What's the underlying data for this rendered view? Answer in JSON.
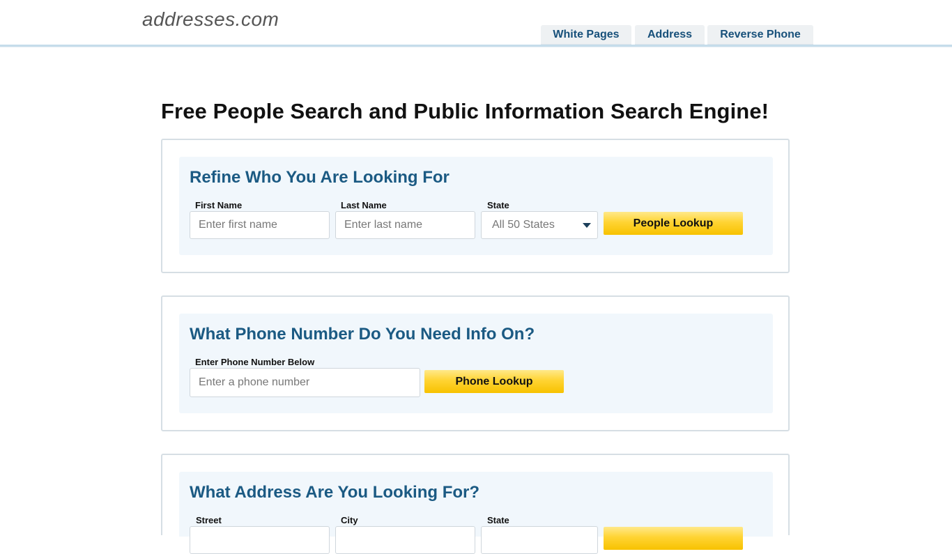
{
  "header": {
    "logo": "addresses.com",
    "nav": [
      {
        "label": "White Pages"
      },
      {
        "label": "Address"
      },
      {
        "label": "Reverse Phone"
      }
    ]
  },
  "page_title": "Free People Search and Public Information Search Engine!",
  "people_search": {
    "heading": "Refine Who You Are Looking For",
    "first_name_label": "First Name",
    "first_name_placeholder": "Enter first name",
    "last_name_label": "Last Name",
    "last_name_placeholder": "Enter last name",
    "state_label": "State",
    "state_value": "All 50 States",
    "button": "People Lookup"
  },
  "phone_search": {
    "heading": "What Phone Number Do You Need Info On?",
    "phone_label": "Enter Phone Number Below",
    "phone_placeholder": "Enter a phone number",
    "button": "Phone Lookup"
  },
  "address_search": {
    "heading": "What Address Are You Looking For?",
    "street_label": "Street",
    "city_label": "City",
    "state_label": "State"
  },
  "colors": {
    "accent_blue": "#1b5a83",
    "button_yellow": "#ffd433",
    "card_background": "#f1f7fc"
  }
}
